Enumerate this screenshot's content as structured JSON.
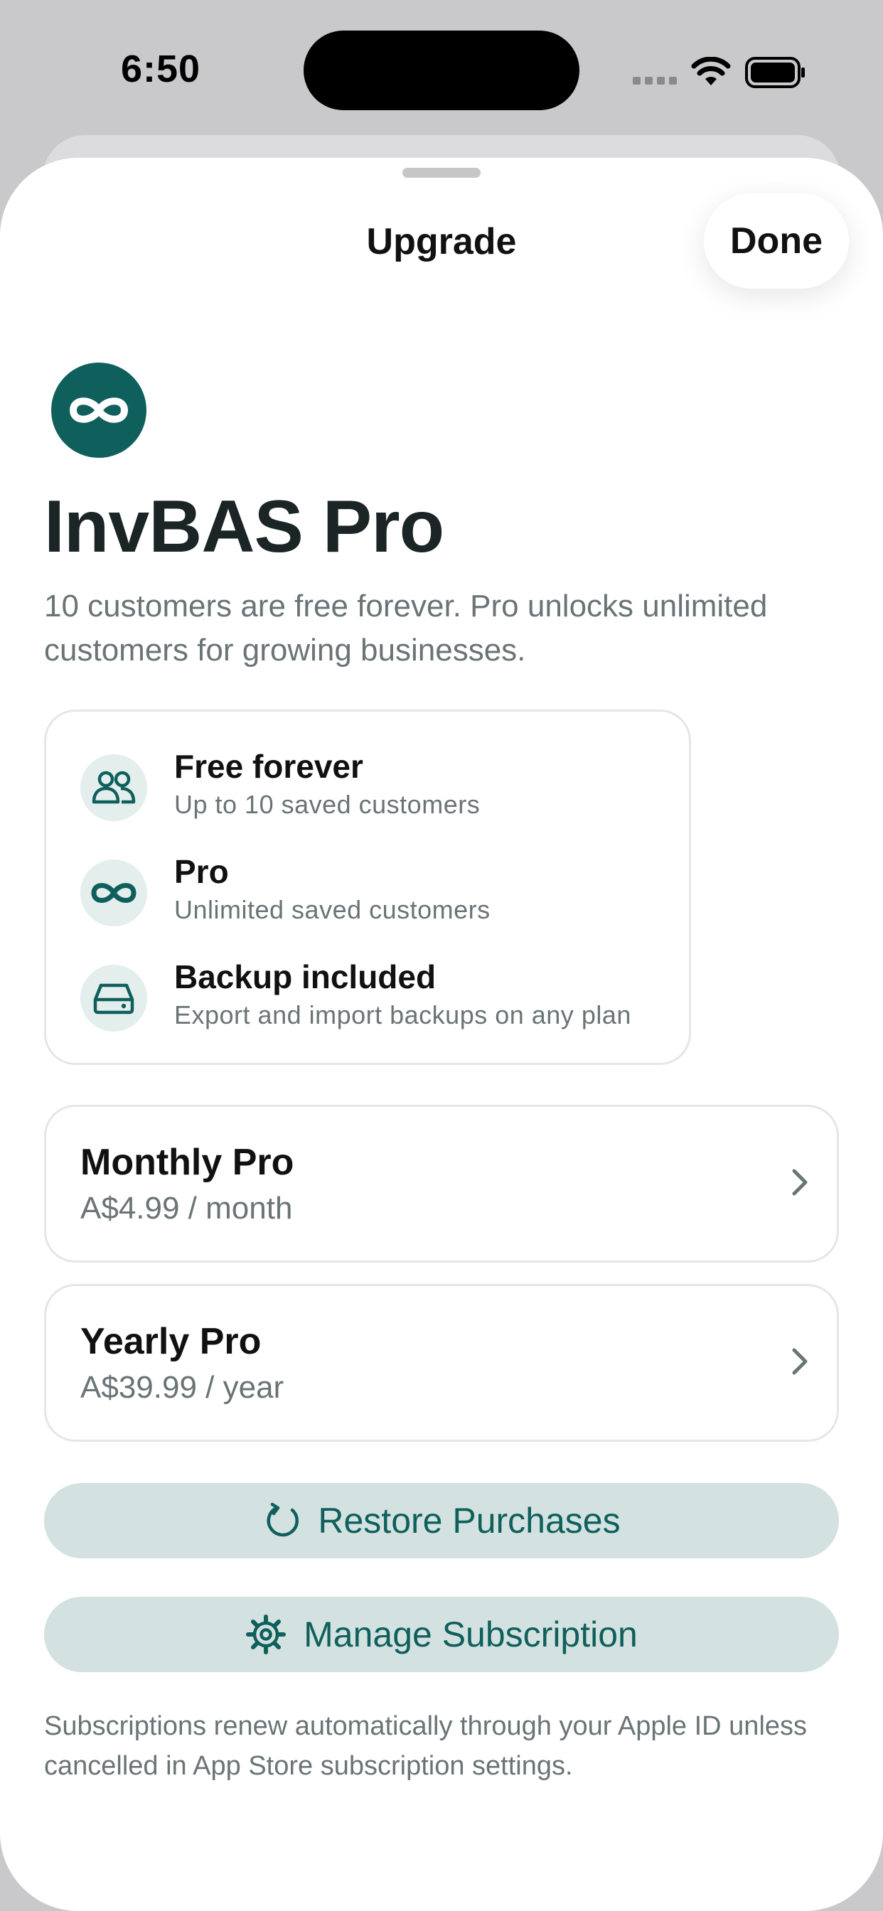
{
  "status_bar": {
    "time": "6:50"
  },
  "sheet": {
    "title": "Upgrade",
    "done_label": "Done"
  },
  "hero": {
    "title": "InvBAS Pro",
    "subtitle": "10 customers are free forever. Pro unlocks unlimited customers for growing businesses."
  },
  "features": [
    {
      "icon": "people-icon",
      "title": "Free forever",
      "desc": "Up to 10 saved customers"
    },
    {
      "icon": "infinity-icon",
      "title": "Pro",
      "desc": "Unlimited saved customers"
    },
    {
      "icon": "drive-icon",
      "title": "Backup included",
      "desc": "Export and import backups on any plan"
    }
  ],
  "plans": [
    {
      "name": "Monthly Pro",
      "price": "A$4.99 / month"
    },
    {
      "name": "Yearly Pro",
      "price": "A$39.99 / year"
    }
  ],
  "actions": {
    "restore_label": "Restore Purchases",
    "manage_label": "Manage Subscription"
  },
  "footnote": "Subscriptions renew automatically through your Apple ID unless cancelled in App Store subscription settings.",
  "colors": {
    "accent": "#0f5f5c",
    "pill_bg": "#d3e2e0",
    "muted": "#6a7476"
  }
}
